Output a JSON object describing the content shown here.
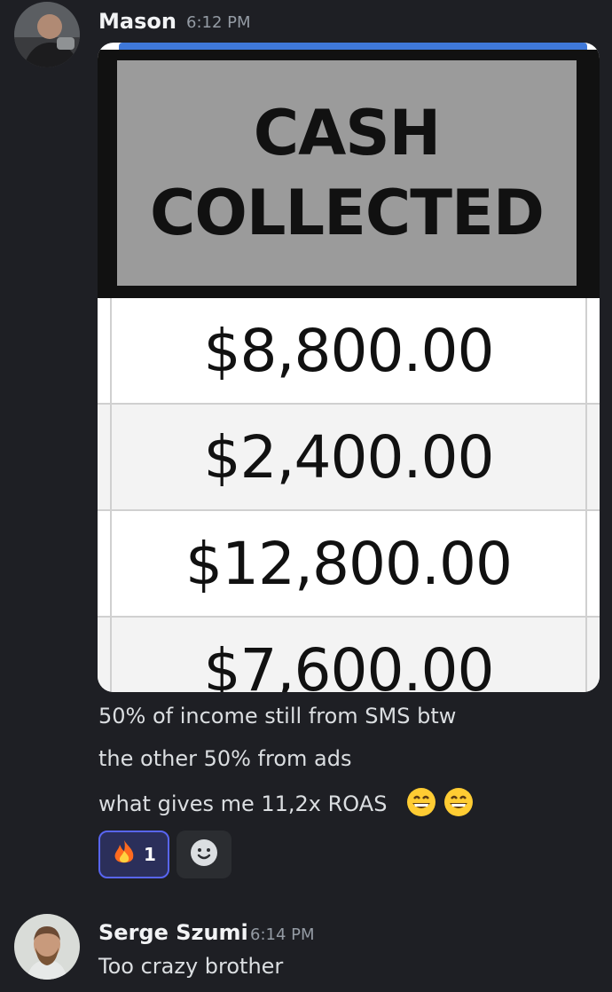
{
  "messages": [
    {
      "author": "Mason",
      "time": "6:12 PM",
      "lines": [
        "50% of income still from SMS btw",
        "the other 50% from ads",
        "what gives me 11,2x ROAS"
      ],
      "trailing_emoji": "grinning-face-with-smiling-eyes x2",
      "attachment": {
        "header": [
          "CASH",
          "COLLECTED"
        ],
        "rows": [
          "$8,800.00",
          "$2,400.00",
          "$12,800.00",
          "$7,600.00"
        ]
      },
      "reactions": [
        {
          "emoji": "fire",
          "count": "1"
        },
        {
          "emoji": "add-reaction-smiley"
        }
      ]
    },
    {
      "author": "Serge Szumi",
      "time": "6:14 PM",
      "lines": [
        "Too crazy brother"
      ]
    }
  ],
  "colors": {
    "background": "#1e1f24",
    "accent": "#5865f2",
    "reaction_bg": "#2b2f5a",
    "muted": "#949ba4"
  }
}
